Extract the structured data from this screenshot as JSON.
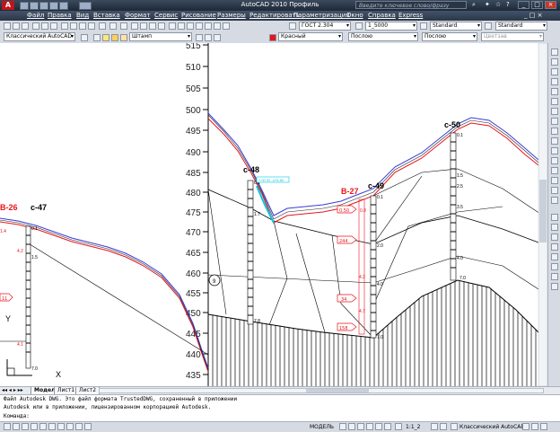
{
  "window": {
    "title": "AutoCAD 2010    Профиль",
    "search_placeholder": "Введите ключевое слово/фразу"
  },
  "menu": [
    "Файл",
    "Правка",
    "Вид",
    "Вставка",
    "Формат",
    "Сервис",
    "Рисование",
    "Размеры",
    "Редактировать",
    "Параметризация",
    "Окно",
    "Справка",
    "Express"
  ],
  "toolbar1": {
    "text_style": "ГОСТ 2.304",
    "dim_scale": "1_5000",
    "table_style": "Standard",
    "multileader_style": "Standard"
  },
  "toolbar2": {
    "workspace": "Классический AutoCAD",
    "layer": "Штамп",
    "color": "Красный",
    "linetype": "Послою",
    "lineweight": "Послою",
    "plotstyle": "Цветзав"
  },
  "drawing": {
    "y_ticks": [
      "515",
      "510",
      "505",
      "500",
      "495",
      "490",
      "485",
      "480",
      "475",
      "470",
      "465",
      "460",
      "455",
      "450",
      "445",
      "440",
      "435"
    ],
    "wells": [
      {
        "label": "с-47",
        "depth_top": "0.1",
        "mid": "1.5",
        "bottom": "7.0"
      },
      {
        "label": "с-48",
        "depth_top": "0.1",
        "mid": "1.7",
        "bottom": "7.8"
      },
      {
        "label": "с-49",
        "depth_top": "0.1",
        "mid": "2.0",
        "mid2": "4.0",
        "bottom": "7.0"
      },
      {
        "label": "с-50",
        "depth_top": "0.1",
        "d1": "1.5",
        "d2": "2.5",
        "d3": "3.5",
        "d4": "4.0",
        "bottom": "7.0"
      }
    ],
    "b26": "В-26",
    "b27": "В-27",
    "red_top": "0.8",
    "red_mid": "4.2",
    "red_low": "4.7",
    "left_label_top": "1.4",
    "left_label_mid": "4.2",
    "left_label_lower": "4.1",
    "left_box": "11",
    "cyan_label": "7.00 02 -474.80",
    "circle_label": "9",
    "red_boxes": [
      "0.50",
      "244",
      "34",
      "158"
    ]
  },
  "tabs": [
    "Модель",
    "Лист1",
    "Лист2"
  ],
  "command": {
    "line1": "Файл Autodesk DWG. Это файл формата TrustedDWG, сохраненный в приложении",
    "line2": "Autodesk или в приложении, лицензированном корпорацией Autodesk.",
    "prompt": "Команда:"
  },
  "status": {
    "coords": "",
    "model": "МОДЕЛЬ",
    "scale": "1:1_2",
    "workspace": "Классический AutoCAD"
  },
  "colors": {
    "title_bg": "#2b3747",
    "toolbar_bg": "#d6dbe3",
    "profile_red": "#e8141d",
    "profile_blue": "#3b3bd6",
    "cyan": "#00c8e0"
  }
}
